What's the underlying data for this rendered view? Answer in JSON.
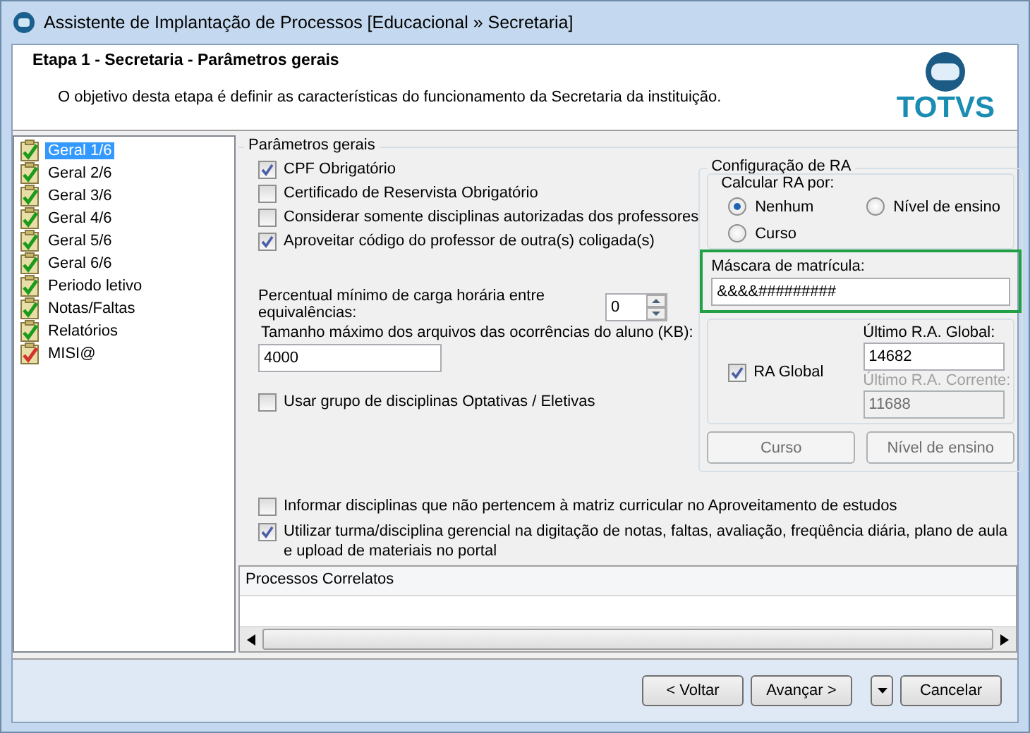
{
  "window": {
    "title": "Assistente de Implantação de Processos [Educacional » Secretaria]"
  },
  "header": {
    "title": "Etapa 1 - Secretaria - Parâmetros gerais",
    "description": "O objetivo desta etapa é definir as características do funcionamento da Secretaria da instituição.",
    "logo": "TOTVS"
  },
  "steps": [
    {
      "label": "Geral 1/6",
      "selected": true,
      "color": "#1c9a1c"
    },
    {
      "label": "Geral 2/6",
      "selected": false,
      "color": "#1c9a1c"
    },
    {
      "label": "Geral 3/6",
      "selected": false,
      "color": "#1c9a1c"
    },
    {
      "label": "Geral 4/6",
      "selected": false,
      "color": "#1c9a1c"
    },
    {
      "label": "Geral 5/6",
      "selected": false,
      "color": "#1c9a1c"
    },
    {
      "label": "Geral 6/6",
      "selected": false,
      "color": "#1c9a1c"
    },
    {
      "label": "Periodo letivo",
      "selected": false,
      "color": "#1c9a1c"
    },
    {
      "label": "Notas/Faltas",
      "selected": false,
      "color": "#1c9a1c"
    },
    {
      "label": "Relatórios",
      "selected": false,
      "color": "#1c9a1c"
    },
    {
      "label": "MISI@",
      "selected": false,
      "color": "#d4332b"
    }
  ],
  "parametros_gerais": {
    "title": "Parâmetros gerais",
    "options": [
      {
        "label": "CPF Obrigatório",
        "checked": true
      },
      {
        "label": "Certificado de Reservista Obrigatório",
        "checked": false
      },
      {
        "label": "Considerar somente disciplinas autorizadas dos professores",
        "checked": false
      },
      {
        "label": "Aproveitar código do professor de outra(s) coligada(s)",
        "checked": true
      }
    ],
    "percent": {
      "label": "Percentual mínimo de carga horária entre equivalências:",
      "value": "0"
    },
    "max_size": {
      "label": "Tamanho máximo dos arquivos das ocorrências do aluno (KB):",
      "value": "4000"
    },
    "optional_group": {
      "label": "Usar grupo de disciplinas Optativas / Eletivas",
      "checked": false
    }
  },
  "configuracao_ra": {
    "title": "Configuração de RA",
    "calcular": {
      "title": "Calcular RA por:",
      "options": [
        {
          "label": "Nenhum",
          "selected": true
        },
        {
          "label": "Nível de ensino",
          "selected": false
        },
        {
          "label": "Curso",
          "selected": false
        }
      ]
    },
    "mask": {
      "label": "Máscara de matrícula:",
      "value": "&&&&#########",
      "highlighted": true
    },
    "ra_global": {
      "label": "RA Global",
      "checked": true
    },
    "ultimo_global": {
      "label": "Último R.A. Global:",
      "value": "14682",
      "disabled": false
    },
    "ultimo_corrente": {
      "label": "Último R.A. Corrente:",
      "value": "11688",
      "disabled": true
    },
    "buttons": [
      "Curso",
      "Nível de ensino"
    ]
  },
  "bottom_options": [
    {
      "label": "Informar disciplinas que não pertencem à matriz curricular no Aproveitamento de estudos",
      "checked": false
    },
    {
      "label": "Utilizar turma/disciplina gerencial na digitação de notas, faltas, avaliação, freqüência diária, plano de aula e upload de materiais no portal",
      "checked": true
    }
  ],
  "processos_correlatos": {
    "title": "Processos Correlatos"
  },
  "buttons": [
    "< Voltar",
    "Avançar >",
    "Cancelar"
  ]
}
